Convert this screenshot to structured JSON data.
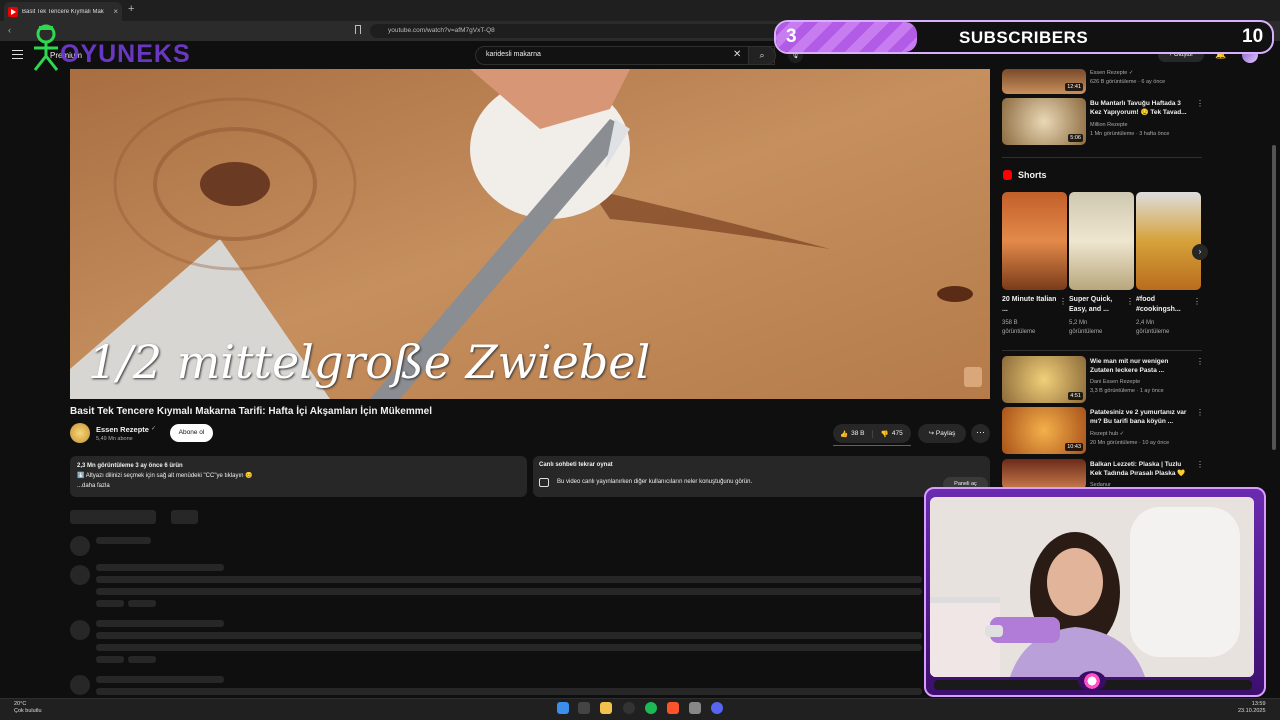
{
  "browser": {
    "tab_title": "Basit Tek Tencere Kıymalı Mak",
    "tab_close": "×",
    "new_tab": "+",
    "url": "youtube.com/watch?v=afM7gVxT-Q8"
  },
  "header": {
    "search_value": "karidesli makarna",
    "create_label": "+ Oluştur",
    "premium_label": "Premium"
  },
  "overlay": {
    "logo_text": "OYUNEKS",
    "sub_count": "3",
    "sub_label": "SUBSCRIBERS",
    "sub_goal": "10",
    "sub_progress": 0.3
  },
  "video": {
    "subtitle": "1/2 mittelgroße Zwiebel",
    "title": "Basit Tek Tencere Kıymalı Makarna Tarifi: Hafta İçi Akşamları İçin Mükemmel",
    "channel": "Essen Rezepte",
    "subscribers": "5,49 Mn abone",
    "subscribe_label": "Abone ol",
    "likes": "38 B",
    "dislikes": "475",
    "share_label": "Paylaş",
    "more_label": "⋯"
  },
  "description": {
    "meta": "2,3 Mn görüntüleme  3 ay önce  6 ürün",
    "line1": "⬇️ Altyazı dilinizi seçmek için sağ alt menüdeki \"CC\"ye tıklayın 😊",
    "more": "...daha fazla"
  },
  "chat": {
    "title": "Canlı sohbeti tekrar oynat",
    "text": "Bu video canlı yayınlanırken diğer kullanıcıların neler konuştuğunu görün.",
    "button": "Paneli aç"
  },
  "sidebar": {
    "top_items": [
      {
        "title": "",
        "channel": "Essen Rezepte ✓",
        "stats": "626 B görüntüleme · 6 ay önce",
        "duration": "12:41"
      },
      {
        "title": "Bu Mantarlı Tavuğu Haftada 3 Kez Yapıyorum! 🤤 Tek Tavad...",
        "channel": "Million Rezepte",
        "stats": "1 Mn görüntüleme · 3 hafta önce",
        "duration": "5:06"
      }
    ],
    "shorts_heading": "Shorts",
    "shorts": [
      {
        "title": "20 Minute Italian ...",
        "views": "358 B görüntüleme"
      },
      {
        "title": "Super Quick, Easy, and ...",
        "views": "5,2 Mn görüntüleme"
      },
      {
        "title": "#food #cookingsh...",
        "views": "2,4 Mn görüntüleme"
      }
    ],
    "bottom_items": [
      {
        "title": "Wie man mit nur wenigen Zutaten leckere Pasta ...",
        "channel": "Dani Essen Rezepte",
        "stats": "3,3 B görüntüleme · 1 ay önce",
        "duration": "4:51"
      },
      {
        "title": "Patatesiniz ve 2 yumurtanız var mı? Bu tarifi bana köyün ...",
        "channel": "Rezept hub ✓",
        "stats": "20 Mn görüntüleme · 10 ay önce",
        "duration": "10:43"
      },
      {
        "title": "Balkan Lezzeti: Plaska | Tuzlu Kek Tadında Pırasalı Plaska 💛",
        "channel": "Sedanur",
        "stats": "",
        "duration": ""
      }
    ]
  },
  "taskbar": {
    "temp": "20°C",
    "weather": "Çok bulutlu",
    "time": "13:59",
    "date": "23.10.2025"
  }
}
